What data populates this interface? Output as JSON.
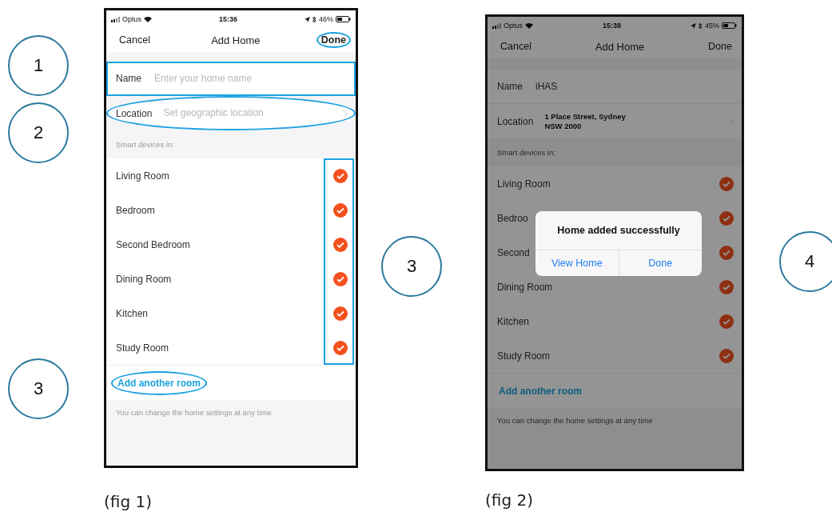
{
  "annotations": [
    {
      "number": "1"
    },
    {
      "number": "2"
    },
    {
      "number": "3"
    },
    {
      "number": "3"
    },
    {
      "number": "4"
    }
  ],
  "figures": [
    {
      "caption": "(fig 1)",
      "dimmed": false,
      "status": {
        "carrier": "Optus",
        "time": "15:36",
        "battery": "46%"
      },
      "nav": {
        "cancel": "Cancel",
        "title": "Add Home",
        "done": "Done",
        "done_highlighted": true
      },
      "name": {
        "label": "Name",
        "placeholder": "Enter your home name",
        "highlighted": true
      },
      "location": {
        "label": "Location",
        "placeholder": "Set geographic location",
        "highlighted": true
      },
      "section_label": "Smart devices in:",
      "rooms": [
        {
          "name": "Living Room",
          "checked": true
        },
        {
          "name": "Bedroom",
          "checked": true
        },
        {
          "name": "Second Bedroom",
          "checked": true
        },
        {
          "name": "Dining Room",
          "checked": true
        },
        {
          "name": "Kitchen",
          "checked": true
        },
        {
          "name": "Study Room",
          "checked": true
        }
      ],
      "checks_highlighted": true,
      "add_room": {
        "label": "Add another room",
        "highlighted": true
      },
      "footer": "You can change the home settings at any time"
    },
    {
      "caption": "(fig 2)",
      "dimmed": true,
      "status": {
        "carrier": "Optus",
        "time": "15:38",
        "battery": "45%"
      },
      "nav": {
        "cancel": "Cancel",
        "title": "Add Home",
        "done": "Done",
        "done_highlighted": false
      },
      "name": {
        "label": "Name",
        "value": "iHAS",
        "highlighted": false
      },
      "location": {
        "label": "Location",
        "value": "1 Place Street, Sydney\nNSW 2000",
        "highlighted": false
      },
      "section_label": "Smart devices in:",
      "rooms": [
        {
          "name": "Living Room",
          "checked": true
        },
        {
          "name": "Bedroo",
          "checked": true
        },
        {
          "name": "Second",
          "checked": true
        },
        {
          "name": "Dining Room",
          "checked": true
        },
        {
          "name": "Kitchen",
          "checked": true
        },
        {
          "name": "Study Room",
          "checked": true
        }
      ],
      "checks_highlighted": false,
      "add_room": {
        "label": "Add another room",
        "highlighted": false
      },
      "footer": "You can change the home settings at any time",
      "dialog": {
        "message": "Home added successfully",
        "buttons": [
          "View Home",
          "Done"
        ]
      }
    }
  ]
}
